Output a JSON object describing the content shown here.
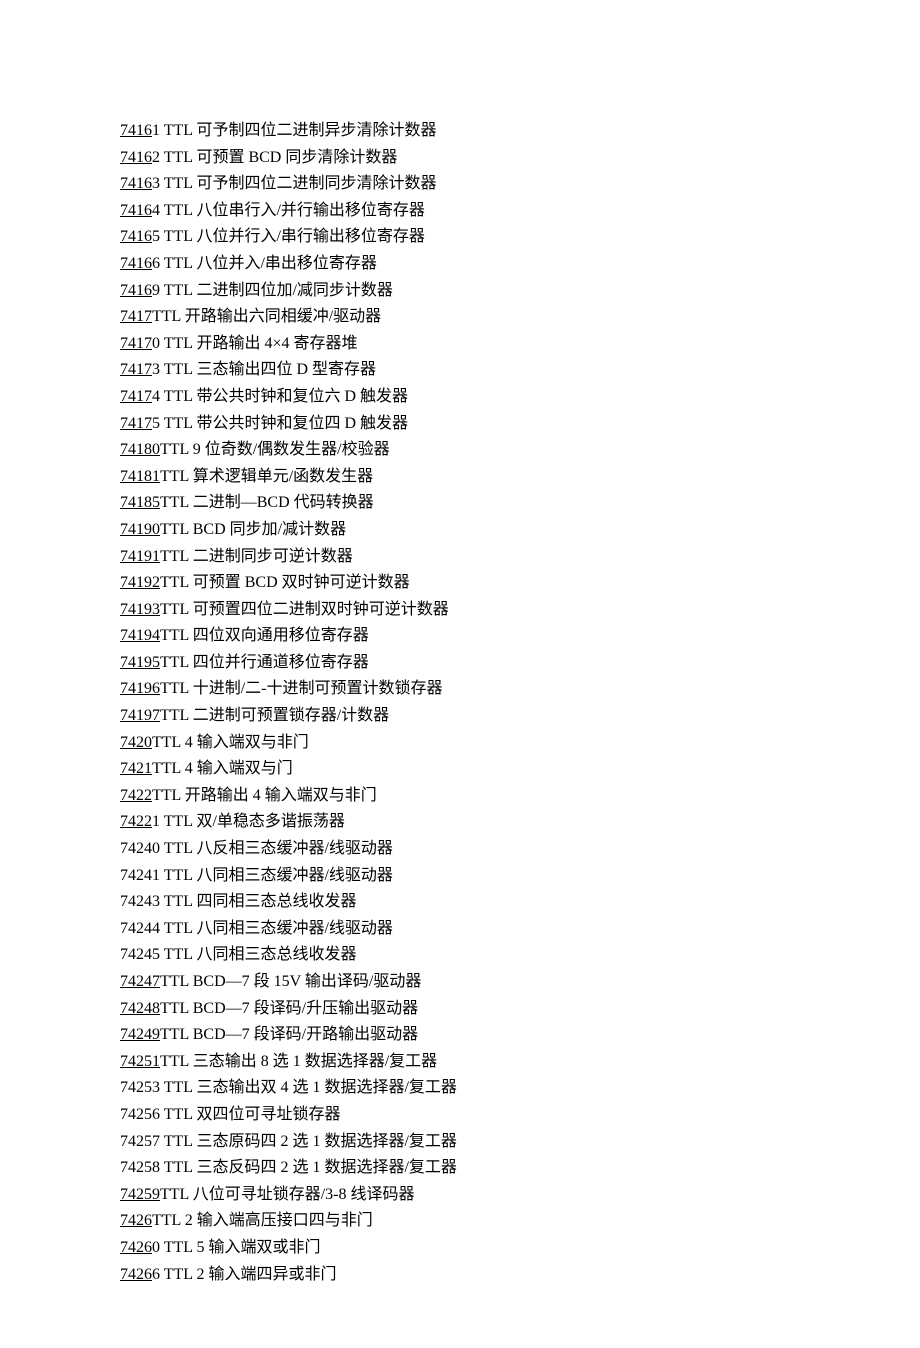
{
  "items": [
    {
      "link": "7416",
      "rest": "1 TTL 可予制四位二进制异步清除计数器",
      "hasLink": true
    },
    {
      "link": "7416",
      "rest": "2 TTL 可预置 BCD 同步清除计数器",
      "hasLink": true
    },
    {
      "link": "7416",
      "rest": "3 TTL 可予制四位二进制同步清除计数器",
      "hasLink": true
    },
    {
      "link": "7416",
      "rest": "4 TTL 八位串行入/并行输出移位寄存器",
      "hasLink": true
    },
    {
      "link": "7416",
      "rest": "5 TTL 八位并行入/串行输出移位寄存器",
      "hasLink": true
    },
    {
      "link": "7416",
      "rest": "6 TTL 八位并入/串出移位寄存器",
      "hasLink": true
    },
    {
      "link": "7416",
      "rest": "9 TTL 二进制四位加/减同步计数器",
      "hasLink": true
    },
    {
      "link": "7417",
      "rest": "TTL 开路输出六同相缓冲/驱动器",
      "hasLink": true
    },
    {
      "link": "7417",
      "rest": "0 TTL 开路输出 4×4 寄存器堆",
      "hasLink": true
    },
    {
      "link": "7417",
      "rest": "3 TTL 三态输出四位 D 型寄存器",
      "hasLink": true
    },
    {
      "link": "7417",
      "rest": "4 TTL 带公共时钟和复位六 D 触发器",
      "hasLink": true
    },
    {
      "link": "7417",
      "rest": "5 TTL 带公共时钟和复位四 D 触发器",
      "hasLink": true
    },
    {
      "link": "74180",
      "rest": "TTL 9 位奇数/偶数发生器/校验器",
      "hasLink": true
    },
    {
      "link": "74181",
      "rest": "TTL 算术逻辑单元/函数发生器",
      "hasLink": true
    },
    {
      "link": "74185",
      "rest": "TTL 二进制—BCD 代码转换器",
      "hasLink": true
    },
    {
      "link": "74190",
      "rest": "TTL BCD 同步加/减计数器",
      "hasLink": true
    },
    {
      "link": "74191",
      "rest": "TTL 二进制同步可逆计数器",
      "hasLink": true
    },
    {
      "link": "74192",
      "rest": "TTL 可预置 BCD 双时钟可逆计数器",
      "hasLink": true
    },
    {
      "link": "74193",
      "rest": "TTL 可预置四位二进制双时钟可逆计数器",
      "hasLink": true
    },
    {
      "link": "74194",
      "rest": "TTL 四位双向通用移位寄存器",
      "hasLink": true
    },
    {
      "link": "74195",
      "rest": "TTL 四位并行通道移位寄存器",
      "hasLink": true
    },
    {
      "link": "74196",
      "rest": "TTL 十进制/二-十进制可预置计数锁存器",
      "hasLink": true
    },
    {
      "link": "74197",
      "rest": "TTL 二进制可预置锁存器/计数器",
      "hasLink": true
    },
    {
      "link": "7420",
      "rest": "TTL 4 输入端双与非门",
      "hasLink": true
    },
    {
      "link": "7421",
      "rest": "TTL 4 输入端双与门",
      "hasLink": true
    },
    {
      "link": "7422",
      "rest": "TTL 开路输出 4 输入端双与非门",
      "hasLink": true
    },
    {
      "link": "7422",
      "rest": "1 TTL 双/单稳态多谐振荡器",
      "hasLink": true
    },
    {
      "link": "",
      "rest": "74240 TTL 八反相三态缓冲器/线驱动器",
      "hasLink": false
    },
    {
      "link": "",
      "rest": "74241 TTL 八同相三态缓冲器/线驱动器",
      "hasLink": false
    },
    {
      "link": "",
      "rest": "74243 TTL 四同相三态总线收发器",
      "hasLink": false
    },
    {
      "link": "",
      "rest": "74244 TTL 八同相三态缓冲器/线驱动器",
      "hasLink": false
    },
    {
      "link": "",
      "rest": "74245 TTL 八同相三态总线收发器",
      "hasLink": false
    },
    {
      "link": "74247",
      "rest": "TTL BCD—7 段 15V 输出译码/驱动器",
      "hasLink": true
    },
    {
      "link": "74248",
      "rest": "TTL BCD—7 段译码/升压输出驱动器",
      "hasLink": true
    },
    {
      "link": "74249",
      "rest": "TTL BCD—7 段译码/开路输出驱动器",
      "hasLink": true
    },
    {
      "link": "74251",
      "rest": "TTL 三态输出 8 选 1 数据选择器/复工器",
      "hasLink": true
    },
    {
      "link": "",
      "rest": "74253 TTL 三态输出双 4 选 1 数据选择器/复工器",
      "hasLink": false
    },
    {
      "link": "",
      "rest": "74256 TTL 双四位可寻址锁存器",
      "hasLink": false
    },
    {
      "link": "",
      "rest": "74257 TTL 三态原码四 2 选 1 数据选择器/复工器",
      "hasLink": false
    },
    {
      "link": "",
      "rest": "74258 TTL 三态反码四 2 选 1 数据选择器/复工器",
      "hasLink": false
    },
    {
      "link": "74259",
      "rest": "TTL 八位可寻址锁存器/3-8 线译码器",
      "hasLink": true
    },
    {
      "link": "7426",
      "rest": "TTL 2 输入端高压接口四与非门",
      "hasLink": true
    },
    {
      "link": "7426",
      "rest": "0 TTL 5 输入端双或非门",
      "hasLink": true
    },
    {
      "link": "7426",
      "rest": "6 TTL 2 输入端四异或非门",
      "hasLink": true
    }
  ]
}
